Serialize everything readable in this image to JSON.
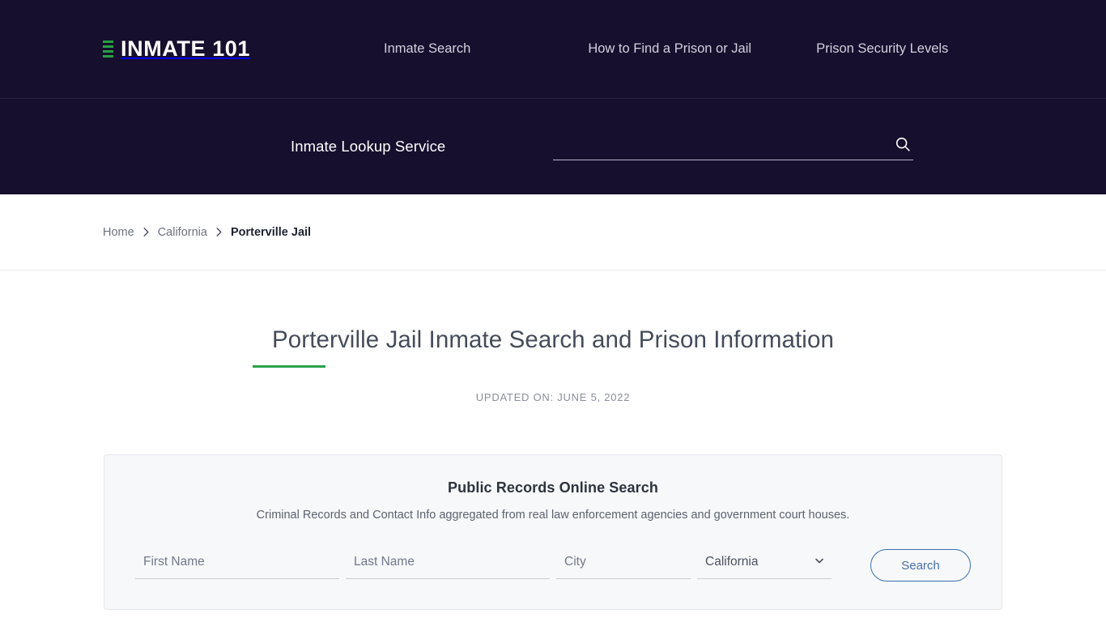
{
  "header": {
    "brand": {
      "name": "INMATE 101",
      "mark_icon": "bars-logo-icon",
      "mark_color": "#27a03f"
    },
    "nav": [
      {
        "label": "Inmate Search"
      },
      {
        "label": "How to Find a Prison or Jail"
      },
      {
        "label": "Prison Security Levels"
      }
    ],
    "lookup_label": "Inmate Lookup Service",
    "search": {
      "value": "",
      "placeholder": "",
      "icon": "search-icon"
    }
  },
  "breadcrumb": {
    "separator_icon": "chevron-right-icon",
    "items": [
      {
        "label": "Home",
        "current": false
      },
      {
        "label": "California",
        "current": false
      },
      {
        "label": "Porterville Jail",
        "current": true
      }
    ]
  },
  "main": {
    "title": "Porterville Jail Inmate Search and Prison Information",
    "accent_color": "#2ba14a",
    "updated_on": "UPDATED ON: JUNE 5, 2022"
  },
  "records_card": {
    "title": "Public Records Online Search",
    "subtitle": "Criminal Records and Contact Info aggregated from real law enforcement agencies and government court houses.",
    "fields": {
      "first_name": {
        "placeholder": "First Name",
        "value": ""
      },
      "last_name": {
        "placeholder": "Last Name",
        "value": ""
      },
      "city": {
        "placeholder": "City",
        "value": ""
      },
      "state": {
        "value": "California",
        "caret_icon": "chevron-down-icon"
      }
    },
    "submit_label": "Search"
  }
}
